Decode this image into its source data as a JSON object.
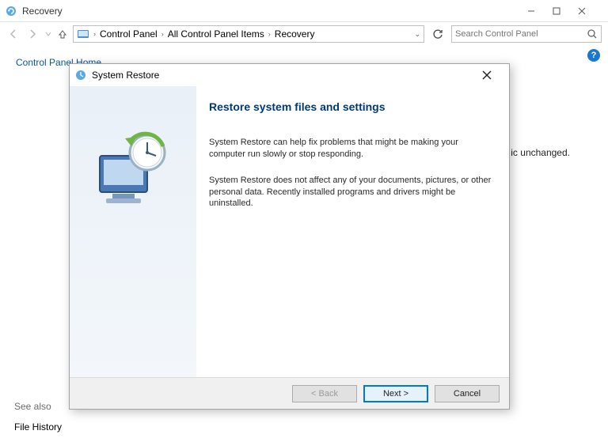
{
  "window": {
    "title": "Recovery",
    "min_label": "Minimize",
    "max_label": "Maximize",
    "close_label": "Close"
  },
  "nav": {
    "crumb1": "Control Panel",
    "crumb2": "All Control Panel Items",
    "crumb3": "Recovery",
    "search_placeholder": "Search Control Panel"
  },
  "sidepane": {
    "home": "Control Panel Home"
  },
  "background": {
    "fragment": "ic unchanged."
  },
  "bottom": {
    "seealso": "See also",
    "filehistory": "File History"
  },
  "dialog": {
    "title": "System Restore",
    "heading": "Restore system files and settings",
    "p1": "System Restore can help fix problems that might be making your computer run slowly or stop responding.",
    "p2": "System Restore does not affect any of your documents, pictures, or other personal data. Recently installed programs and drivers might be uninstalled.",
    "back": "< Back",
    "next": "Next >",
    "cancel": "Cancel"
  }
}
